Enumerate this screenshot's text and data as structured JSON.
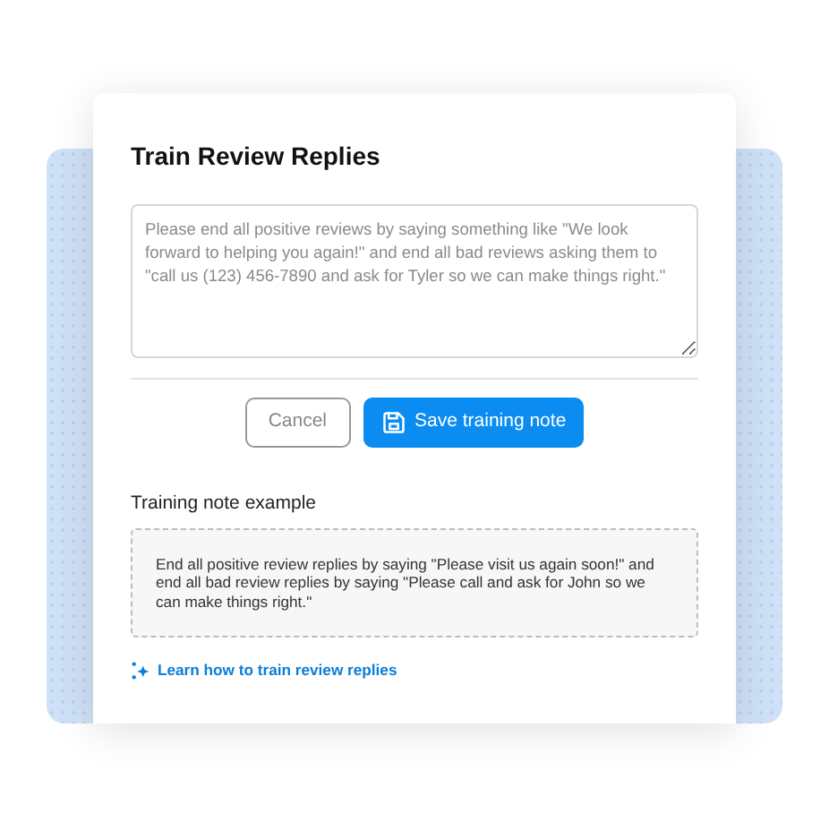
{
  "dialog": {
    "title": "Train Review Replies",
    "note_field": {
      "placeholder": "Please end all positive reviews by saying something like \"We look forward to helping you again!\" and end all bad reviews asking them to \"call us (123) 456-7890 and ask for Tyler so we can make things right.\""
    },
    "buttons": [
      {
        "label": "Cancel",
        "kind": "secondary"
      },
      {
        "label": "Save training note",
        "kind": "primary"
      }
    ],
    "example": {
      "heading": "Training note example",
      "text": "End all positive review replies by saying \"Please visit us again soon!\" and end all bad review replies by saying \"Please call and ask for John so we can make things right.\""
    },
    "help_link": "Learn how to train review replies"
  }
}
